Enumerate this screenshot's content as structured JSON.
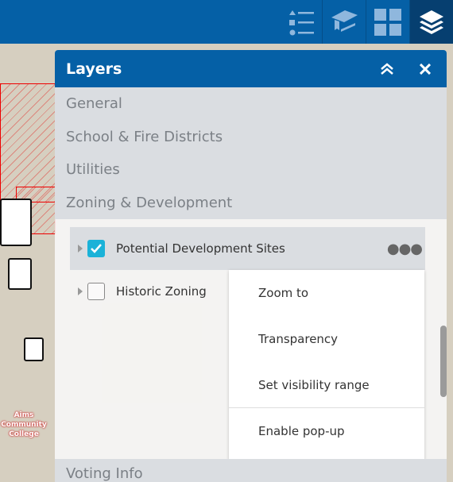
{
  "toolbar": {
    "tabs": [
      {
        "name": "legend"
      },
      {
        "name": "tutorial"
      },
      {
        "name": "basemap-gallery"
      },
      {
        "name": "layers",
        "active": true
      }
    ]
  },
  "map": {
    "label": "Aims Community College"
  },
  "panel": {
    "title": "Layers",
    "categories": [
      "General",
      "School & Fire Districts",
      "Utilities",
      "Zoning & Development"
    ],
    "layers": [
      {
        "label": "Potential Development Sites",
        "checked": true
      },
      {
        "label": "Historic Zoning",
        "checked": false
      }
    ],
    "menu": [
      "Zoom to",
      "Transparency",
      "Set visibility range",
      "Enable pop-up"
    ],
    "next_category": "Voting Info"
  },
  "colors": {
    "header": "#0560a6",
    "active_tab": "#063f70",
    "checkbox": "#1ab2d8"
  }
}
